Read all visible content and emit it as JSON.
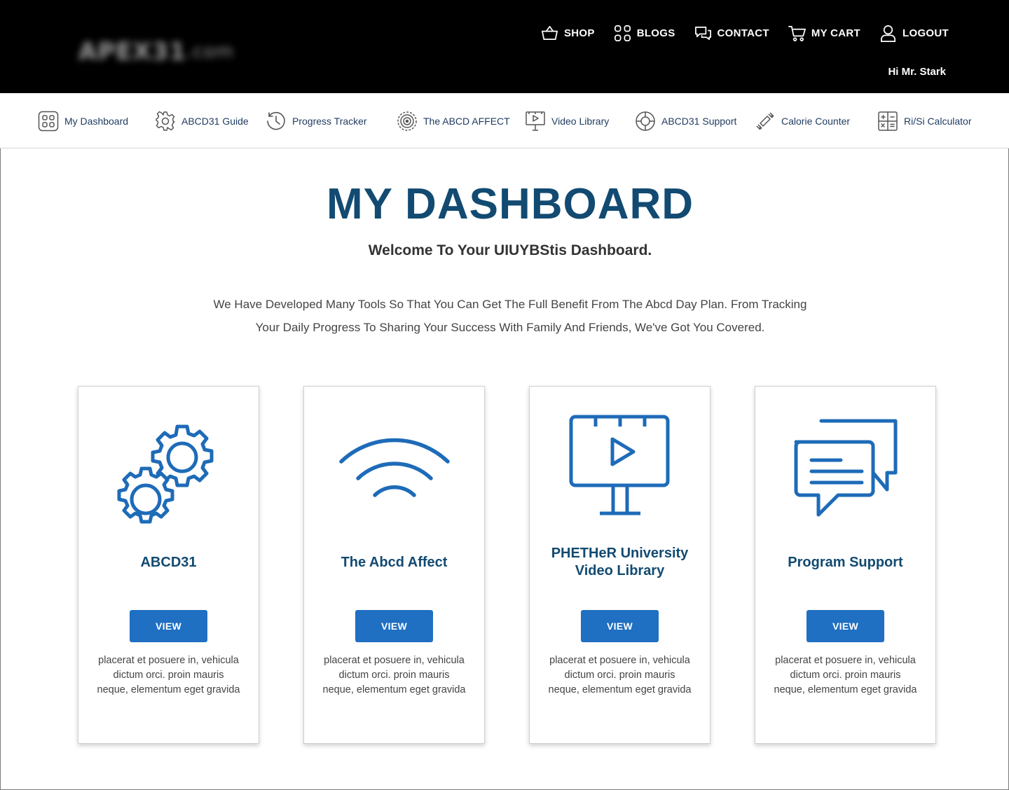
{
  "header": {
    "logo_text": "APEX31",
    "logo_suffix": ".com",
    "nav": [
      {
        "label": "SHOP",
        "icon": "basket-icon"
      },
      {
        "label": "BLOGS",
        "icon": "grid-icon"
      },
      {
        "label": "CONTACT",
        "icon": "chat-icon"
      },
      {
        "label": "MY CART",
        "icon": "cart-icon"
      },
      {
        "label": "LOGOUT",
        "icon": "user-icon"
      }
    ],
    "greeting": "Hi Mr. Stark"
  },
  "subnav": [
    {
      "label": "My Dashboard",
      "icon": "dashboard-icon"
    },
    {
      "label": "ABCD31 Guide",
      "icon": "gear-icon"
    },
    {
      "label": "Progress Tracker",
      "icon": "clock-icon"
    },
    {
      "label": "The ABCD AFFECT",
      "icon": "target-icon"
    },
    {
      "label": "Video Library",
      "icon": "video-board-icon"
    },
    {
      "label": "ABCD31 Support",
      "icon": "lifebuoy-icon"
    },
    {
      "label": "Calorie Counter",
      "icon": "dumbbell-icon"
    },
    {
      "label": "Ri/Si Calculator",
      "icon": "calculator-icon"
    }
  ],
  "main": {
    "title": "MY DASHBOARD",
    "subtitle": "Welcome To Your UIUYBStis Dashboard.",
    "intro_line1": "We Have Developed Many Tools So That You Can Get The Full Benefit From The Abcd Day Plan. From Tracking",
    "intro_line2": "Your Daily Progress To Sharing Your Success With Family And Friends, We've Got You Covered."
  },
  "cards": [
    {
      "title": "ABCD31",
      "button": "VIEW",
      "icon": "gears-icon",
      "desc": "placerat et posuere in, vehicula dictum orci. proin mauris neque, elementum eget gravida"
    },
    {
      "title": "The Abcd Affect",
      "button": "VIEW",
      "icon": "wifi-icon",
      "desc": "placerat et posuere in, vehicula dictum orci. proin mauris neque, elementum eget gravida"
    },
    {
      "title": "PHETHeR University Video Library",
      "button": "VIEW",
      "icon": "video-monitor-icon",
      "desc": "placerat et posuere in, vehicula dictum orci. proin mauris neque, elementum eget gravida"
    },
    {
      "title": "Program Support",
      "button": "VIEW",
      "icon": "chat-bubbles-icon",
      "desc": "placerat et posuere in, vehicula dictum orci. proin mauris neque, elementum eget gravida"
    }
  ],
  "colors": {
    "topbar": "#000000",
    "title": "#124a71",
    "accent": "#1f6fc2",
    "icon": "#1e6bb8"
  }
}
